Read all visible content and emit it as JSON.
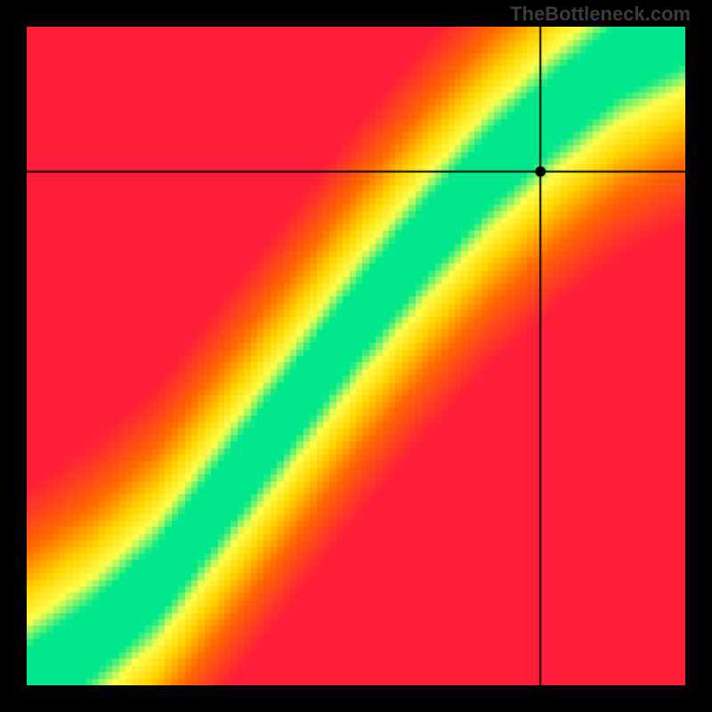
{
  "watermark": "TheBottleneck.com",
  "chart_data": {
    "type": "heatmap",
    "title": "",
    "xlabel": "",
    "ylabel": "",
    "xlim": [
      0,
      100
    ],
    "ylim": [
      0,
      100
    ],
    "grid": false,
    "legend": false,
    "crosshair": {
      "x": 78,
      "y": 78
    },
    "marker": {
      "x": 78,
      "y": 78
    },
    "optimal_band": {
      "description": "green diagonal band of optimal pairing",
      "points_center": [
        {
          "x": 0,
          "y": 0
        },
        {
          "x": 10,
          "y": 7
        },
        {
          "x": 20,
          "y": 16
        },
        {
          "x": 30,
          "y": 29
        },
        {
          "x": 40,
          "y": 42
        },
        {
          "x": 50,
          "y": 55
        },
        {
          "x": 60,
          "y": 67
        },
        {
          "x": 70,
          "y": 78
        },
        {
          "x": 80,
          "y": 87
        },
        {
          "x": 90,
          "y": 95
        },
        {
          "x": 100,
          "y": 100
        }
      ],
      "band_halfwidth_fraction": 0.055
    },
    "color_scale": [
      {
        "stop": 0.0,
        "color": "#ff1d3a"
      },
      {
        "stop": 0.35,
        "color": "#ff6a00"
      },
      {
        "stop": 0.62,
        "color": "#ffd500"
      },
      {
        "stop": 0.82,
        "color": "#ffff4d"
      },
      {
        "stop": 1.0,
        "color": "#00e88b"
      }
    ]
  }
}
